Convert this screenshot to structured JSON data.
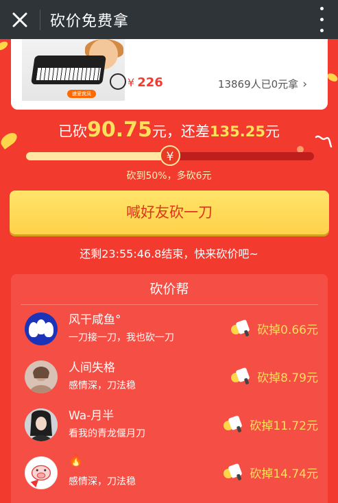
{
  "topbar": {
    "title": "砍价免费拿",
    "close_icon": "close-icon",
    "menu_icon": "more-vertical-icon"
  },
  "product": {
    "tag": "速爱宾凤",
    "price_symbol": "¥",
    "price": "226",
    "people_text": "13869人已0元拿",
    "chevron": "›"
  },
  "progress": {
    "prefix": "已砍",
    "cut_amount": "90.75",
    "mid": "元，还差",
    "remaining": "135.25",
    "suffix": "元",
    "fraction": 0.5,
    "knob_symbol": "¥",
    "hint": "砍到50%，多砍6元"
  },
  "actions": {
    "chop_button": "喊好友砍一刀",
    "countdown": "还剩23:55:46.8结束，快来砍价吧~"
  },
  "helpers": {
    "title": "砍价帮",
    "items": [
      {
        "name": "风干咸鱼°",
        "message": "一刀接一刀，我也砍一刀",
        "amount": "砍掉0.66元"
      },
      {
        "name": "人间失格",
        "message": "感情深，刀法稳",
        "amount": "砍掉8.79元"
      },
      {
        "name": "Wa-月半",
        "message": "看我的青龙偃月刀",
        "amount": "砍掉11.72元"
      },
      {
        "name": "🔥",
        "message": "感情深，刀法稳",
        "amount": "砍掉14.74元"
      }
    ]
  },
  "colors": {
    "background": "#f33a2f",
    "accent": "#ffe05c",
    "button": "#ffd14a",
    "topbar": "#2f3438"
  }
}
